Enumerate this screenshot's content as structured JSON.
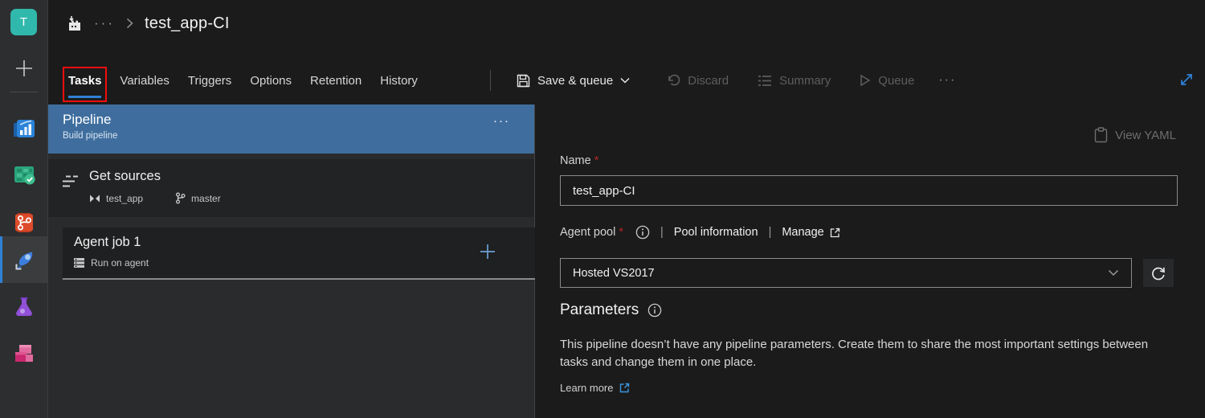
{
  "colors": {
    "accent_blue": "#2f81d7",
    "selection_blue": "#3f6e9e",
    "annotation_red": "#f20d0d",
    "avatar_teal": "#31b8ac",
    "required_red": "#b42525"
  },
  "sidebar": {
    "avatar_letter": "T",
    "items": [
      {
        "name": "overview"
      },
      {
        "name": "boards"
      },
      {
        "name": "repos"
      },
      {
        "name": "pipelines",
        "active": true
      },
      {
        "name": "test-plans"
      },
      {
        "name": "artifacts"
      }
    ]
  },
  "breadcrumb": {
    "ellipsis": "···",
    "title": "test_app-CI"
  },
  "tabs": [
    {
      "label": "Tasks",
      "active": true
    },
    {
      "label": "Variables"
    },
    {
      "label": "Triggers"
    },
    {
      "label": "Options"
    },
    {
      "label": "Retention"
    },
    {
      "label": "History"
    }
  ],
  "toolbar": {
    "save_queue": "Save & queue",
    "discard": "Discard",
    "summary": "Summary",
    "queue": "Queue",
    "more": "···"
  },
  "left_panel": {
    "pipeline": {
      "title": "Pipeline",
      "subtitle": "Build pipeline",
      "more": "···"
    },
    "get_sources": {
      "title": "Get sources",
      "repo": "test_app",
      "branch": "master"
    },
    "agent_job": {
      "title": "Agent job 1",
      "subtitle": "Run on agent"
    }
  },
  "right_panel": {
    "view_yaml": "View YAML",
    "name_field": {
      "label": "Name",
      "required": "*",
      "value": "test_app-CI"
    },
    "agent_pool": {
      "label": "Agent pool",
      "required": "*",
      "separator": "|",
      "pool_information": "Pool information",
      "manage": "Manage",
      "value": "Hosted VS2017"
    },
    "parameters": {
      "heading": "Parameters",
      "description": "This pipeline doesn’t have any pipeline parameters. Create them to share the most important settings between tasks and change them in one place.",
      "learn_more": "Learn more"
    }
  }
}
